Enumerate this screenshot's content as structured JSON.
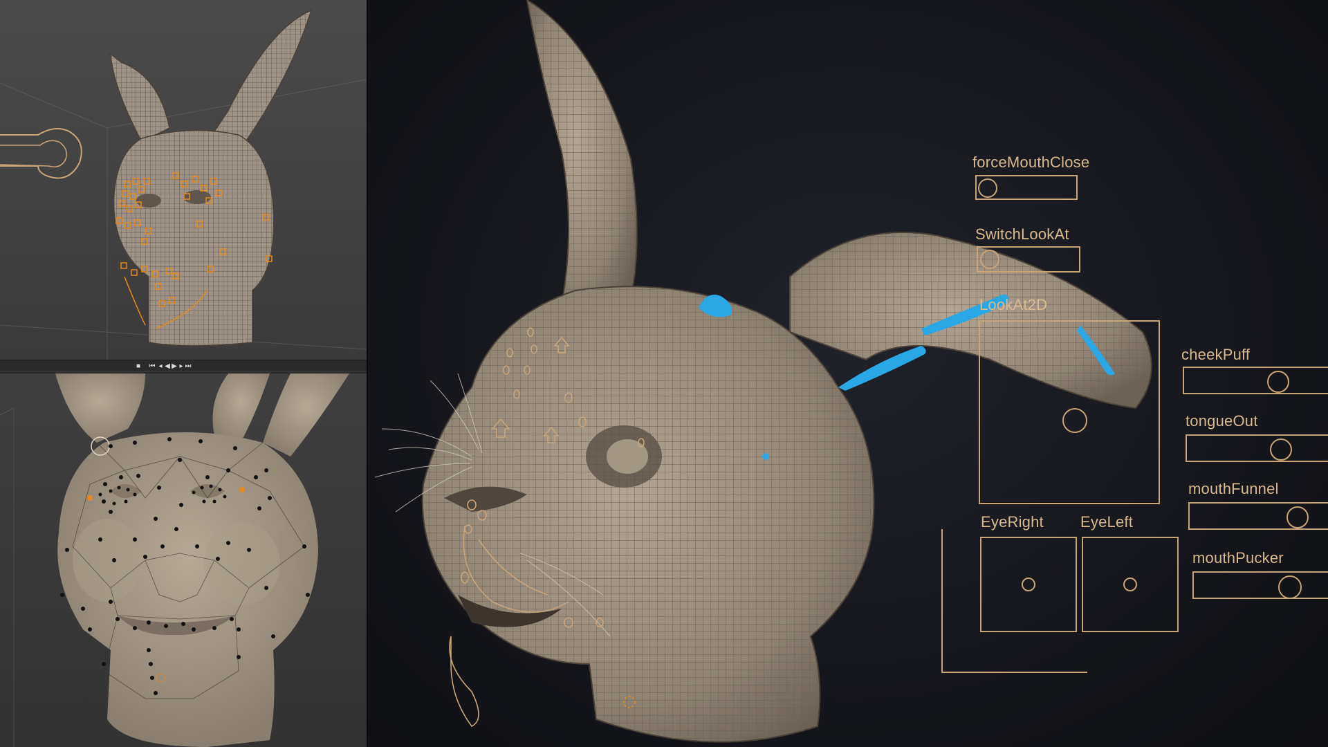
{
  "colors": {
    "rig_control": "#caa57a",
    "rig_label": "#d9b98f",
    "mesh": "#9d9285",
    "mesh_wire": "#5f564c",
    "joint_blue": "#2aa8e6",
    "orange_selection": "#e8891c",
    "viewport_bg": "#15161b"
  },
  "viewports": {
    "top_left": {
      "name": "wireframe-rig-viewport"
    },
    "bottom_left": {
      "name": "face-joints-viewport"
    },
    "main": {
      "name": "facial-controls-viewport"
    }
  },
  "timeline": {
    "buttons": [
      "stop-icon",
      "go-start-icon",
      "step-back-icon",
      "play-back-icon",
      "play-icon",
      "step-forward-icon",
      "go-end-icon"
    ]
  },
  "controls": {
    "force_mouth_close": "forceMouthClose",
    "switch_look_at": "SwitchLookAt",
    "look_at_2d": "LookAt2D",
    "cheek_puff": "cheekPuff",
    "tongue_out": "tongueOut",
    "mouth_funnel": "mouthFunnel",
    "mouth_pucker": "mouthPucker",
    "eye_right": "EyeRight",
    "eye_left": "EyeLeft"
  }
}
